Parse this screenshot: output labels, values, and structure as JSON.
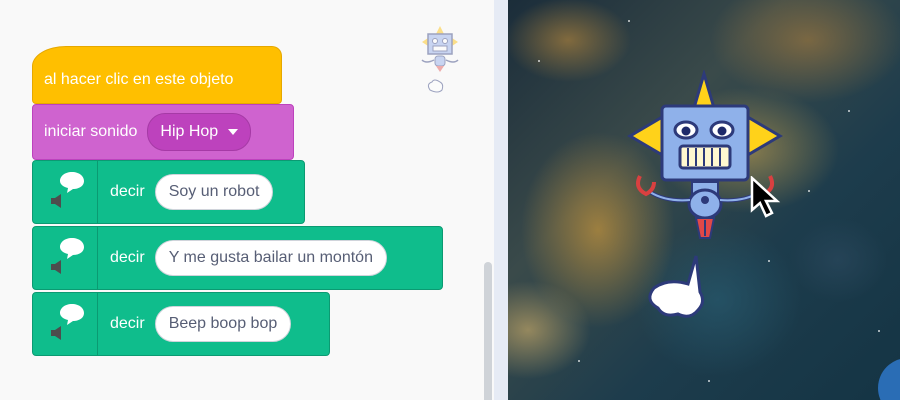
{
  "blocks": {
    "hat_label": "al hacer clic en este objeto",
    "sound_label": "iniciar sonido",
    "sound_value": "Hip Hop",
    "say_blocks": [
      {
        "label": "decir",
        "text": "Soy un robot"
      },
      {
        "label": "decir",
        "text": "Y me gusta bailar un montón"
      },
      {
        "label": "decir",
        "text": "Beep boop bop"
      }
    ]
  },
  "icons": {
    "dropdown": "chevron-down-icon",
    "speech": "speech-bubble-icon",
    "speaker": "speaker-icon",
    "cursor": "mouse-pointer-icon"
  },
  "colors": {
    "events": "#ffbf00",
    "sound": "#cf63cf",
    "text_to_speech": "#0fbd8c",
    "text_input": "#575e75"
  }
}
